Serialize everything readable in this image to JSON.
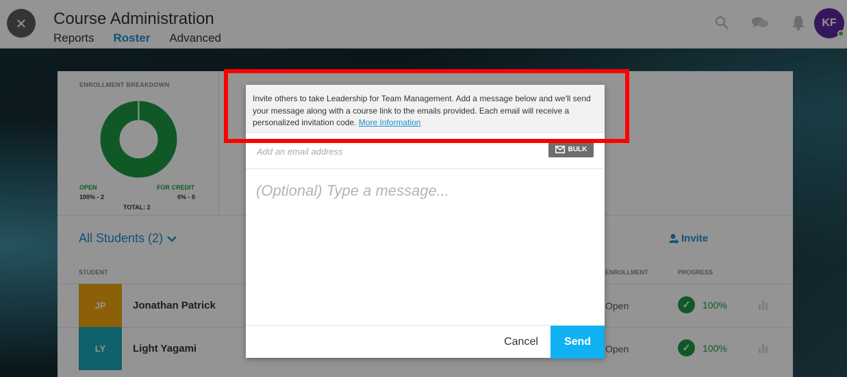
{
  "header": {
    "title": "Course Administration",
    "tabs": [
      {
        "label": "Reports",
        "active": false
      },
      {
        "label": "Roster",
        "active": true
      },
      {
        "label": "Advanced",
        "active": false
      }
    ],
    "icons": [
      "search-icon",
      "chat-icon",
      "bell-icon"
    ],
    "avatar_initials": "KF"
  },
  "enrollment": {
    "title": "ENROLLMENT BREAKDOWN",
    "open_label": "OPEN",
    "open_value": "100% - 2",
    "credit_label": "FOR CREDIT",
    "credit_value": "0% - 0",
    "total": "TOTAL: 2",
    "open_fraction": 1.0
  },
  "roster": {
    "filter_label": "All Students (2)",
    "invite_label": "Invite",
    "columns": {
      "student": "STUDENT",
      "enrollment": "ENROLLMENT",
      "progress": "PROGRESS"
    },
    "rows": [
      {
        "initials": "JP",
        "name": "Jonathan Patrick",
        "enrollment": "Open",
        "progress": "100%",
        "color": "#f0a50f"
      },
      {
        "initials": "LY",
        "name": "Light Yagami",
        "enrollment": "Open",
        "progress": "100%",
        "color": "#1aa7b8"
      }
    ]
  },
  "modal": {
    "info_text": "Invite others to take Leadership for Team Management. Add a message below and we'll send your message along with a course link to the emails provided. Each email will receive a personalized invitation code.",
    "more_link": "More Information",
    "email_placeholder": "Add an email address",
    "bulk_label": "BULK",
    "message_placeholder": "(Optional) Type a message...",
    "cancel_label": "Cancel",
    "send_label": "Send"
  },
  "colors": {
    "accent": "#1a8fd1",
    "send": "#0fb1f3",
    "success": "#1d9a44",
    "highlight": "#ff0000"
  }
}
